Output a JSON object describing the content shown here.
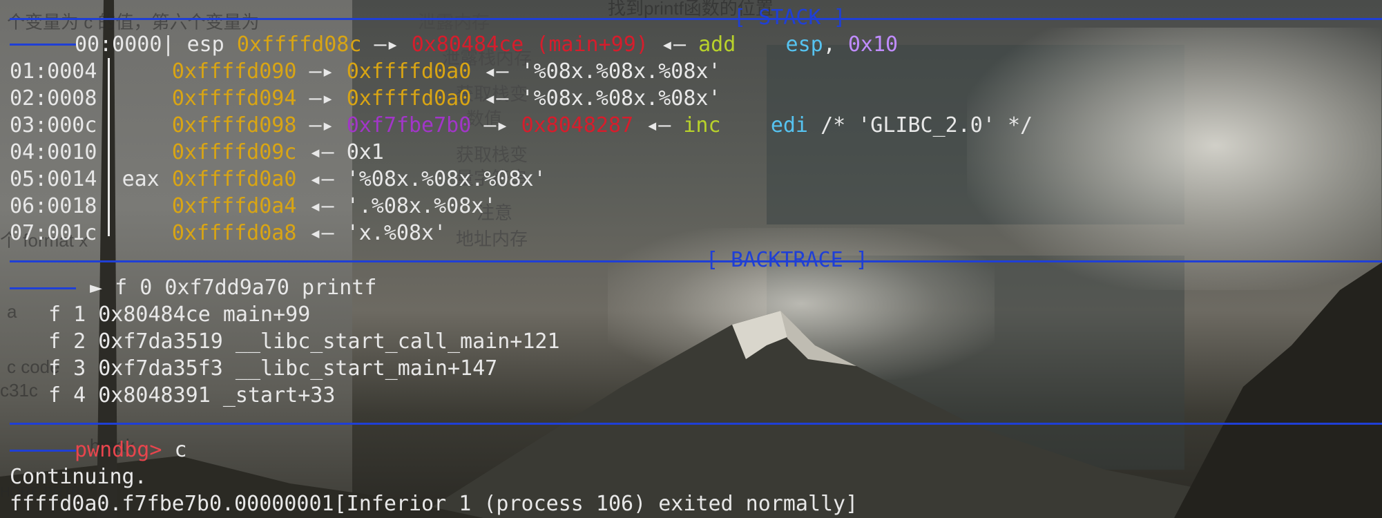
{
  "headers": {
    "stack": "[ STACK ]",
    "backtrace": "[ BACKTRACE ]"
  },
  "stack_rows": [
    {
      "off": "00:0000",
      "reg": "esp",
      "addr": "0xffffd08c",
      "arrow1": "—▸",
      "ptr": "0x80484ce (main+99)",
      "arrow2": "◂—",
      "op": "add",
      "operand": "esp",
      "comma": ",",
      "imm": "0x10"
    },
    {
      "off": "01:0004",
      "addr": "0xffffd090",
      "arrow1": "—▸",
      "ptr": "0xffffd0a0",
      "arrow2": "◂—",
      "str": "'%08x.%08x.%08x'"
    },
    {
      "off": "02:0008",
      "addr": "0xffffd094",
      "arrow1": "—▸",
      "ptr": "0xffffd0a0",
      "arrow2": "◂—",
      "str": "'%08x.%08x.%08x'"
    },
    {
      "off": "03:000c",
      "addr": "0xffffd098",
      "arrow1": "—▸",
      "ptr": "0xf7fbe7b0",
      "arrow2": "—▸",
      "ptr2": "0x8048287",
      "arrow3": "◂—",
      "op": "inc",
      "operand": "edi",
      "comment": "/* 'GLIBC_2.0' */"
    },
    {
      "off": "04:0010",
      "addr": "0xffffd09c",
      "arrow2": "◂—",
      "str": "0x1"
    },
    {
      "off": "05:0014",
      "reg": "eax",
      "addr": "0xffffd0a0",
      "arrow2": "◂—",
      "str": "'%08x.%08x.%08x'"
    },
    {
      "off": "06:0018",
      "addr": "0xffffd0a4",
      "arrow2": "◂—",
      "str": "'.%08x.%08x'"
    },
    {
      "off": "07:001c",
      "addr": "0xffffd0a8",
      "arrow2": "◂—",
      "str": "'x.%08x'"
    }
  ],
  "backtrace": [
    "► f 0 0xf7dd9a70 printf",
    "f 1 0x80484ce main+99",
    "f 2 0xf7da3519 __libc_start_call_main+121",
    "f 3 0xf7da35f3 __libc_start_main+147",
    "f 4 0x8048391 _start+33"
  ],
  "prompt": {
    "label": "pwndbg>",
    "command": "c"
  },
  "output": [
    "Continuing.",
    "ffffd0a0.f7fbe7b0.00000001[Inferior 1 (process 106) exited normally]"
  ],
  "background_text": {
    "left": [
      "个变量为 c 的值，第六个变量为",
      "个 format x",
      "a",
      "c code",
      "c31c",
      "break",
      "HORE PRTB"
    ],
    "middle": [
      "泄露内存",
      "泄露栈内存",
      "获取栈变",
      "数值",
      "获取栈变",
      "量字符串",
      "注意",
      "地址内存"
    ],
    "top": "找到printf函数的位置"
  },
  "colors": {
    "accent_blue": "#1f3fd6",
    "address_yellow": "#d9a514",
    "code_red": "#d61d2c",
    "data_purple": "#a236c8",
    "instr_green": "#b8d22b",
    "reg_cyan": "#56c3f0",
    "prompt_red": "#e8454d"
  }
}
